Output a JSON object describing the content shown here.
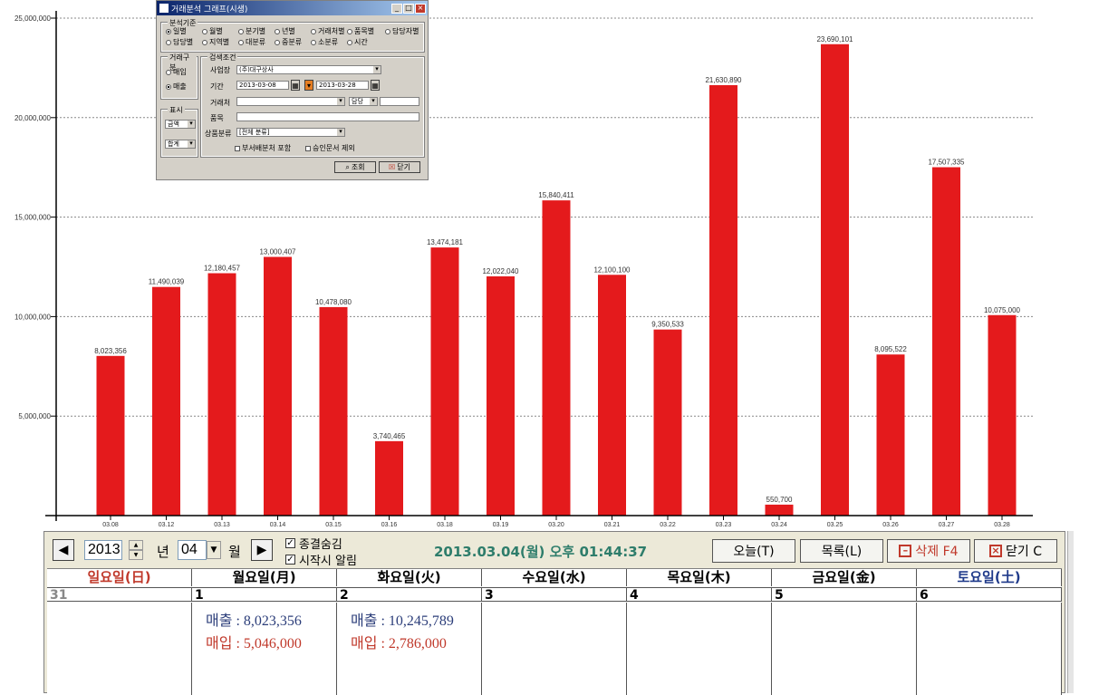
{
  "chart_data": {
    "type": "bar",
    "categories": [
      "03.08",
      "03.12",
      "03.13",
      "03.14",
      "03.15",
      "03.16",
      "03.18",
      "03.19",
      "03.20",
      "03.21",
      "03.22",
      "03.23",
      "03.24",
      "03.25",
      "03.26",
      "03.27",
      "03.28"
    ],
    "values": [
      8023356,
      11490039,
      12180457,
      13000407,
      10478080,
      3740465,
      13474181,
      12022040,
      15840411,
      12100100,
      9350533,
      21630890,
      550700,
      23690101,
      8095522,
      17507335,
      10075000
    ],
    "data_labels": [
      "8,023,356",
      "11,490,039",
      "12,180,457",
      "13,000,407",
      "10,478,080",
      "3,740,465",
      "13,474,181",
      "12,022,040",
      "15,840,411",
      "12,100,100",
      "9,350,533",
      "21,630,890",
      "550,700",
      "23,690,101",
      "8,095,522",
      "17,507,335",
      "10,075,000"
    ],
    "ylim": [
      0,
      25000000
    ],
    "yticks": [
      5000000,
      10000000,
      15000000,
      20000000,
      25000000
    ],
    "ytick_labels": [
      "5,000,000",
      "10,000,000",
      "15,000,000",
      "20,000,000",
      "25,000,000"
    ],
    "grid": true,
    "bar_color": "#e41a1c"
  },
  "dialog": {
    "title": "거래분석 그래프(시생)",
    "group_basis": "분석기준",
    "radios_row1": [
      "일별",
      "월별",
      "분기별",
      "년별",
      "거래처별",
      "품목별",
      "담당자별"
    ],
    "radios_row2": [
      "담당별",
      "지역별",
      "대분류",
      "중분류",
      "소분류",
      "시간"
    ],
    "group_trade": "거래구분",
    "trade_options": [
      "매입",
      "매출"
    ],
    "group_condition": "검색조건",
    "label_business": "사업장",
    "business_value": "(주)대구상사",
    "label_date": "기간",
    "date_from": "2013-03-08",
    "date_to": "2013-03-28",
    "label_customer": "거래처",
    "label_manager": "담당",
    "label_item": "품목",
    "label_category": "상품분류",
    "category_value": "[전체 분류]",
    "check1": "부서배분처 포함",
    "check2": "승인문서 제외",
    "group_display": "표시",
    "display_sel1": "금액",
    "display_sel2": "합계",
    "search_btn": "조회",
    "close_btn": "닫기"
  },
  "calendar": {
    "year": "2013",
    "year_unit": "년",
    "month": "04",
    "month_unit": "월",
    "check_hide": "종결숨김",
    "check_alarm": "시작시 알림",
    "clock": "2013.03.04(월) 오후 01:44:37",
    "btn_today": "오늘(T)",
    "btn_list": "목록(L)",
    "btn_delete": "삭제 F4",
    "btn_close": "닫기 C",
    "weekdays": [
      "일요일(日)",
      "월요일(月)",
      "화요일(火)",
      "수요일(水)",
      "목요일(木)",
      "금요일(金)",
      "토요일(土)"
    ],
    "day_numbers": [
      "31",
      "1",
      "2",
      "3",
      "4",
      "5",
      "6"
    ],
    "mon_sales": "매출 : 8,023,356",
    "mon_purchase": "매입 : 5,046,000",
    "tue_sales": "매출 : 10,245,789",
    "tue_purchase": "매입 : 2,786,000",
    "color_sunday": "#c0392b",
    "color_saturday": "#1f3a8a",
    "color_sales": "#2c3e7a",
    "color_purchase": "#c0392b"
  }
}
